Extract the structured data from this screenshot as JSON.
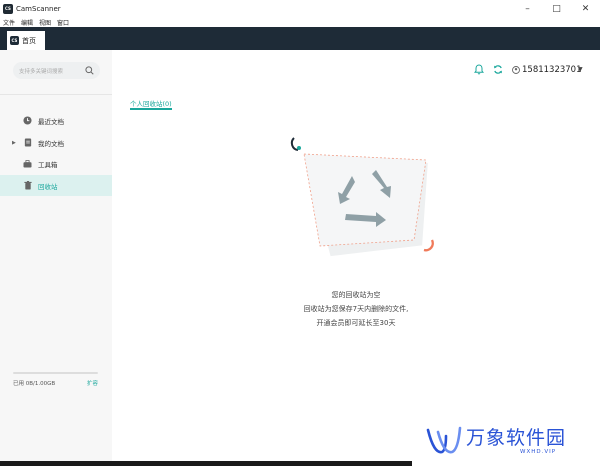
{
  "window": {
    "title": "CamScanner",
    "app_icon_text": "CS"
  },
  "menu": [
    "文件",
    "编辑",
    "视图",
    "窗口"
  ],
  "tab": {
    "label": "首页",
    "icon_text": "CS"
  },
  "sidebar": {
    "search_placeholder": "支持多关键词搜索",
    "items": [
      {
        "label": "最近文档",
        "icon": "clock-icon"
      },
      {
        "label": "我的文档",
        "icon": "document-icon"
      },
      {
        "label": "工具箱",
        "icon": "toolbox-icon"
      },
      {
        "label": "回收站",
        "icon": "trash-icon"
      }
    ],
    "storage_text": "已用 0B/1.00GB",
    "storage_used_fraction": 0,
    "expand_label": "扩容"
  },
  "header": {
    "user": "15811323701"
  },
  "main": {
    "subtab": "个人回收站(0)",
    "empty_title": "您的回收站为空",
    "empty_line1": "回收站为您保存7天内删除的文件,",
    "empty_line2": "开通会员即可延长至30天"
  },
  "watermark": {
    "text": "万象软件园",
    "sub": "WXHD.VIP"
  },
  "colors": {
    "accent": "#1aa79c",
    "tabbar": "#1e2b37",
    "watermark": "#2a53d6",
    "illus_accent": "#f07a5a"
  }
}
